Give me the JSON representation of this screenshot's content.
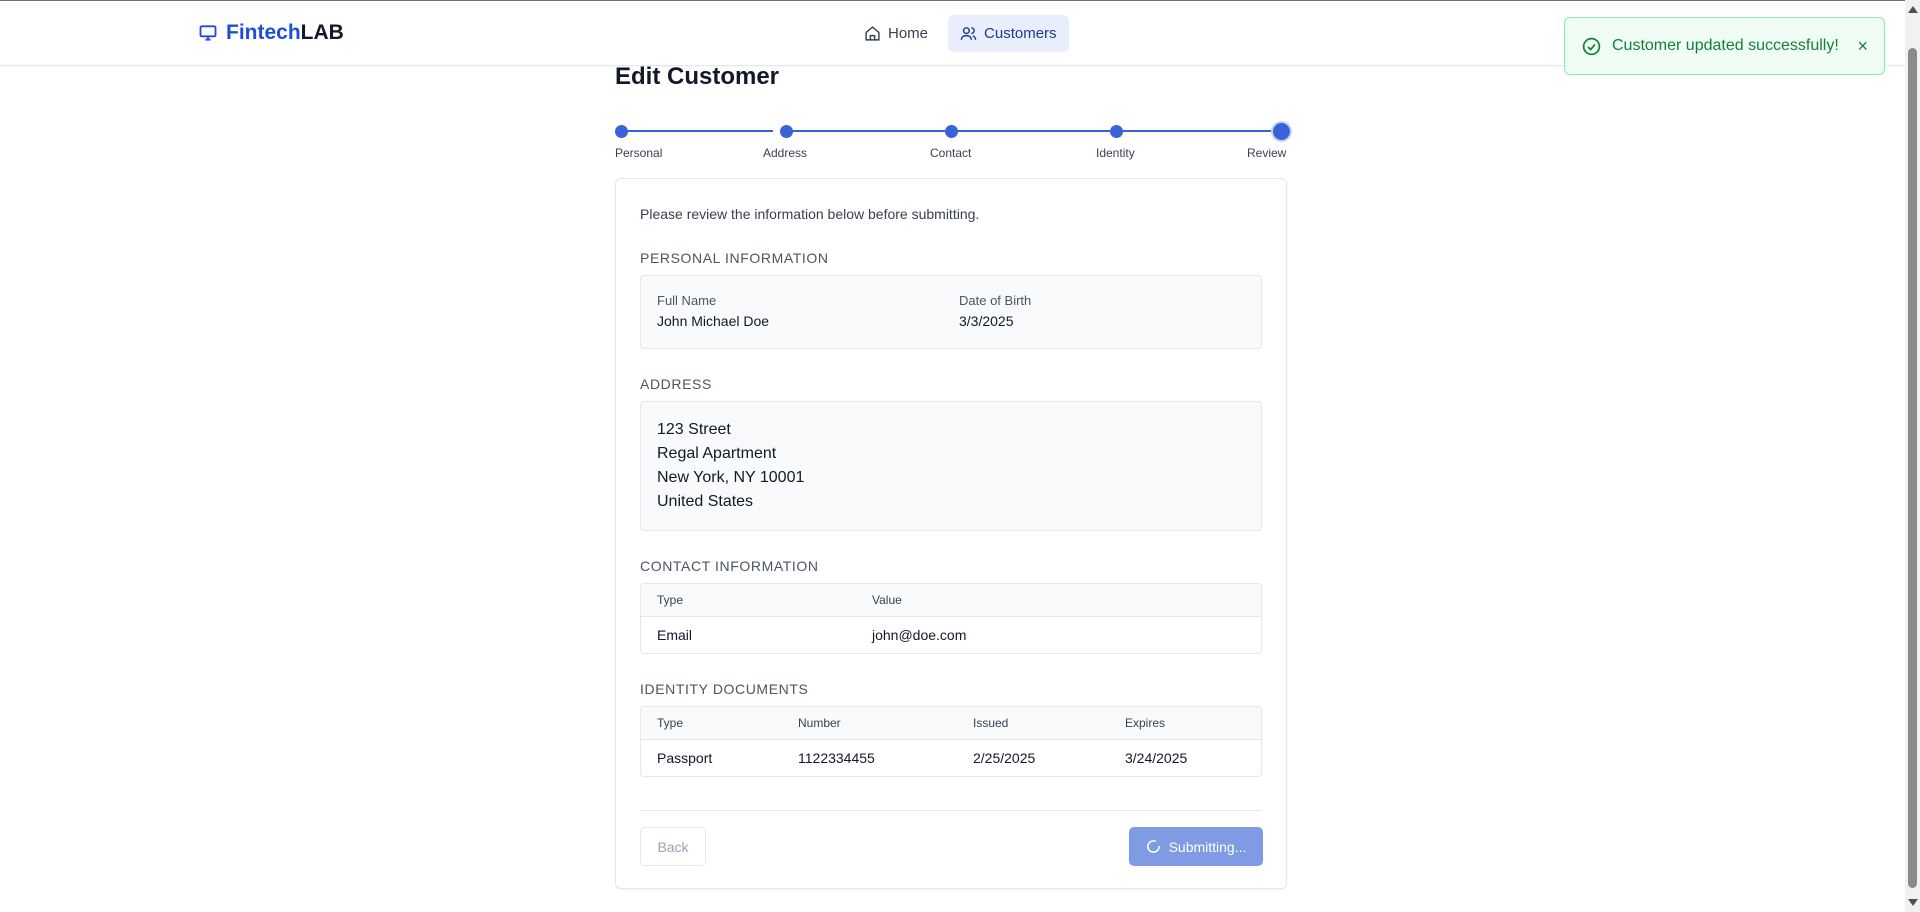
{
  "header": {
    "brand_primary": "Fintech",
    "brand_secondary": "LAB",
    "nav": [
      {
        "label": "Home",
        "icon": "home-icon"
      },
      {
        "label": "Customers",
        "icon": "users-icon",
        "active": true
      }
    ]
  },
  "toast": {
    "message": "Customer updated successfully!",
    "close": "×",
    "icon": "check-circle-icon",
    "color": "#15803d"
  },
  "page": {
    "title": "Edit Customer"
  },
  "stepper": {
    "steps": [
      "Personal",
      "Address",
      "Contact",
      "Identity",
      "Review"
    ],
    "current": "Review",
    "color": "#3b63d9"
  },
  "review": {
    "intro": "Please review the information below before submitting.",
    "personal": {
      "title": "PERSONAL INFORMATION",
      "full_name_label": "Full Name",
      "full_name": "John Michael Doe",
      "dob_label": "Date of Birth",
      "dob": "3/3/2025"
    },
    "address": {
      "title": "ADDRESS",
      "line1": "123 Street",
      "line2": "Regal Apartment",
      "line3": "New York, NY 10001",
      "line4": "United States"
    },
    "contact": {
      "title": "CONTACT INFORMATION",
      "headers": [
        "Type",
        "Value"
      ],
      "rows": [
        [
          "Email",
          "john@doe.com"
        ]
      ]
    },
    "identity": {
      "title": "IDENTITY DOCUMENTS",
      "headers": [
        "Type",
        "Number",
        "Issued",
        "Expires"
      ],
      "rows": [
        [
          "Passport",
          "1122334455",
          "2/25/2025",
          "3/24/2025"
        ]
      ]
    }
  },
  "actions": {
    "back_label": "Back",
    "submit_label": "Submitting..."
  }
}
